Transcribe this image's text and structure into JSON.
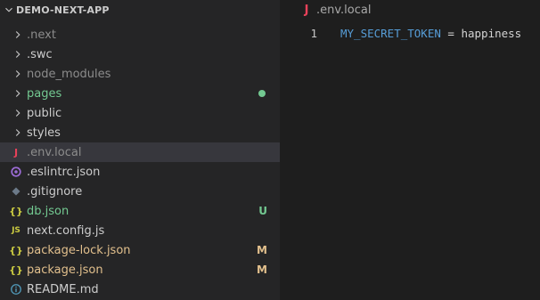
{
  "explorer": {
    "title": "DEMO-NEXT-APP",
    "items": [
      {
        "label": ".next",
        "kind": "folder",
        "color": "#8c8c8c"
      },
      {
        "label": ".swc",
        "kind": "folder",
        "color": "#cccccc"
      },
      {
        "label": "node_modules",
        "kind": "folder",
        "color": "#8c8c8c"
      },
      {
        "label": "pages",
        "kind": "folder",
        "color": "#73c991",
        "decoration": "modified-dot",
        "decoration_color": "#73c991"
      },
      {
        "label": "public",
        "kind": "folder",
        "color": "#cccccc"
      },
      {
        "label": "styles",
        "kind": "folder",
        "color": "#cccccc"
      },
      {
        "label": ".env.local",
        "kind": "file",
        "icon": "env-icon",
        "icon_glyph": "J",
        "icon_color": "#e8415a",
        "color": "#8c8c8c",
        "active": true
      },
      {
        "label": ".eslintrc.json",
        "kind": "file",
        "icon": "eslint-icon",
        "icon_color": "#9b6bd4",
        "color": "#cccccc"
      },
      {
        "label": ".gitignore",
        "kind": "file",
        "icon": "git-icon",
        "icon_color": "#6c7a89",
        "color": "#cccccc"
      },
      {
        "label": "db.json",
        "kind": "file",
        "icon": "json-icon",
        "icon_glyph": "{}",
        "icon_color": "#cbcb41",
        "color": "#73c991",
        "badge": "U",
        "badge_color": "#73c991"
      },
      {
        "label": "next.config.js",
        "kind": "file",
        "icon": "js-icon",
        "icon_glyph": "JS",
        "icon_color": "#cbcb41",
        "color": "#cccccc"
      },
      {
        "label": "package-lock.json",
        "kind": "file",
        "icon": "json-icon",
        "icon_glyph": "{}",
        "icon_color": "#cbcb41",
        "color": "#e2c08d",
        "badge": "M",
        "badge_color": "#e2c08d"
      },
      {
        "label": "package.json",
        "kind": "file",
        "icon": "json-icon",
        "icon_glyph": "{}",
        "icon_color": "#cbcb41",
        "color": "#e2c08d",
        "badge": "M",
        "badge_color": "#e2c08d"
      },
      {
        "label": "README.md",
        "kind": "file",
        "icon": "info-icon",
        "icon_color": "#519aba",
        "color": "#cccccc"
      }
    ]
  },
  "editor": {
    "breadcrumb_file": ".env.local",
    "breadcrumb_icon_glyph": "J",
    "lines": [
      {
        "number": "1",
        "key": "MY_SECRET_TOKEN",
        "operator": " = ",
        "value": "happiness"
      }
    ]
  }
}
